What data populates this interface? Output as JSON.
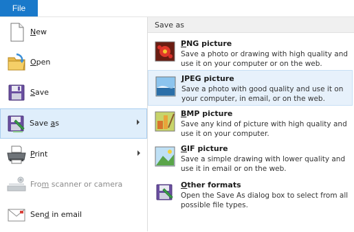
{
  "file_tab": {
    "label": "File"
  },
  "left_menu": [
    {
      "id": "new",
      "prefix": "",
      "key": "N",
      "rest": "ew",
      "enabled": true
    },
    {
      "id": "open",
      "prefix": "",
      "key": "O",
      "rest": "pen",
      "enabled": true
    },
    {
      "id": "save",
      "prefix": "",
      "key": "S",
      "rest": "ave",
      "enabled": true
    },
    {
      "id": "save-as",
      "prefix": "Save ",
      "key": "a",
      "rest": "s",
      "enabled": true,
      "selected": true,
      "has_submenu": true
    },
    {
      "id": "print",
      "prefix": "",
      "key": "P",
      "rest": "rint",
      "enabled": true,
      "has_submenu": true
    },
    {
      "id": "scanner",
      "prefix": "Fro",
      "key": "m",
      "rest": " scanner or camera",
      "enabled": false
    },
    {
      "id": "send-email",
      "prefix": "Sen",
      "key": "d",
      "rest": " in email",
      "enabled": true
    }
  ],
  "submenu": {
    "header": "Save as",
    "options": [
      {
        "id": "png",
        "key": "P",
        "rest": "NG picture",
        "desc": "Save a photo or drawing with high quality and use it on your computer or on the web."
      },
      {
        "id": "jpeg",
        "key": "J",
        "rest": "PEG picture",
        "desc": "Save a photo with good quality and use it on your computer, in email, or on the web.",
        "hover": true
      },
      {
        "id": "bmp",
        "key": "B",
        "rest": "MP picture",
        "desc": "Save any kind of picture with high quality and use it on your computer."
      },
      {
        "id": "gif",
        "key": "G",
        "rest": "IF picture",
        "desc": "Save a simple drawing with lower quality and use it in email or on the web."
      },
      {
        "id": "other",
        "key": "O",
        "rest": "ther formats",
        "desc": "Open the Save As dialog box to select from all possible file types."
      }
    ]
  },
  "icons": {
    "new": "blank-document-icon",
    "open": "folder-icon",
    "save": "floppy-disk-icon",
    "save-as": "save-as-icon",
    "print": "printer-icon",
    "scanner": "scanner-camera-icon",
    "send-email": "email-icon",
    "png": "png-picture-icon",
    "jpeg": "jpeg-picture-icon",
    "bmp": "bmp-picture-icon",
    "gif": "gif-picture-icon",
    "other": "other-formats-icon"
  },
  "colors": {
    "file_tab": "#1979ca",
    "selected_bg": "#dfeefb",
    "hover_bg": "#e7f1fb"
  }
}
